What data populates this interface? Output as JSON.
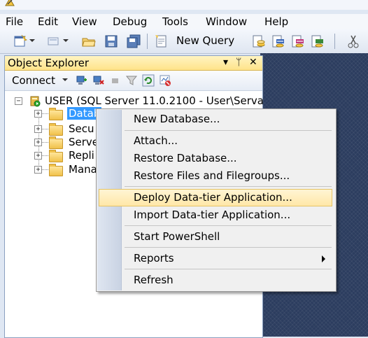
{
  "menubar": {
    "items": [
      "File",
      "Edit",
      "View",
      "Debug",
      "Tools",
      "Window",
      "Help"
    ]
  },
  "toolbar": {
    "new_query_label": "New Query"
  },
  "object_explorer": {
    "title": "Object Explorer",
    "connect_label": "Connect",
    "server_node": "USER (SQL Server 11.0.2100 - User\\Serva",
    "children": [
      "Datab",
      "Secu",
      "Serve",
      "Repli",
      "Mana"
    ]
  },
  "context_menu": {
    "items": [
      "New Database...",
      "Attach...",
      "Restore Database...",
      "Restore Files and Filegroups...",
      "Deploy Data-tier Application...",
      "Import Data-tier Application...",
      "Start PowerShell",
      "Reports",
      "Refresh"
    ]
  },
  "colors": {
    "highlight": "#ffe7a8",
    "selection": "#3399ff",
    "header": "#ffe38a"
  }
}
